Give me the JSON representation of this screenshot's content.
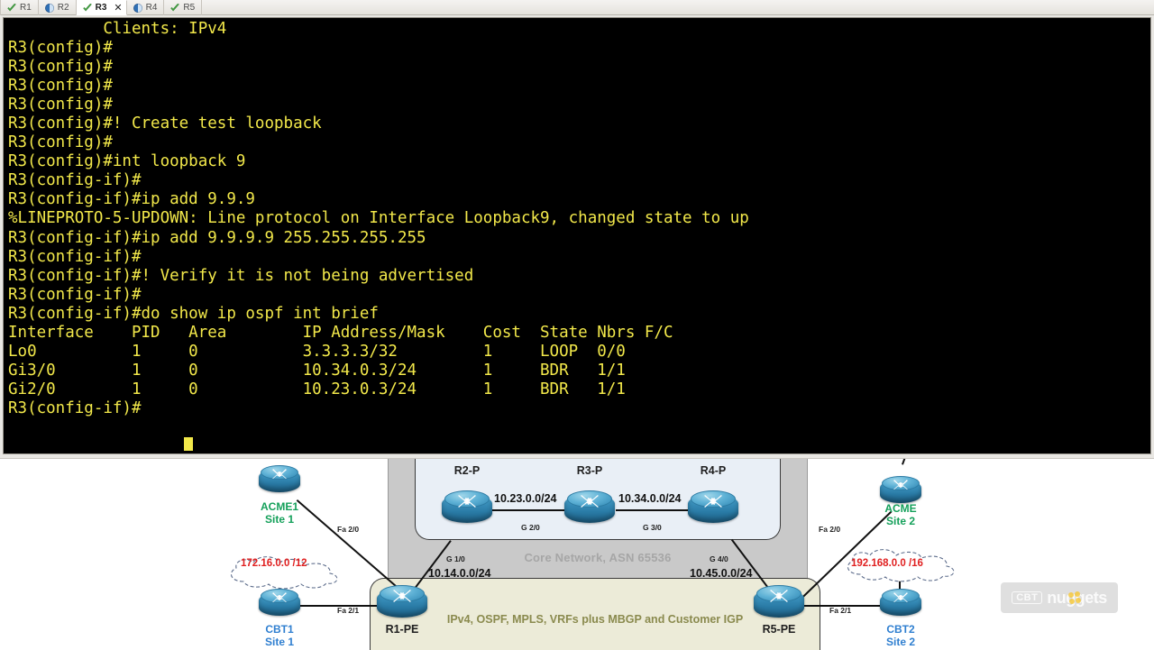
{
  "tabs": [
    {
      "label": "R1",
      "icon": "check-icon",
      "active": false,
      "closable": false
    },
    {
      "label": "R2",
      "icon": "clock-icon",
      "active": false,
      "closable": false
    },
    {
      "label": "R3",
      "icon": "check-icon",
      "active": true,
      "closable": true,
      "close_label": "✕"
    },
    {
      "label": "R4",
      "icon": "clock-icon",
      "active": false,
      "closable": false
    },
    {
      "label": "R5",
      "icon": "check-icon",
      "active": false,
      "closable": false
    }
  ],
  "terminal": {
    "foreground_color": "#f2e84a",
    "background_color": "#000000",
    "text": "          Clients: IPv4\nR3(config)#\nR3(config)#\nR3(config)#\nR3(config)#\nR3(config)#! Create test loopback\nR3(config)#\nR3(config)#int loopback 9\nR3(config-if)#\nR3(config-if)#ip add 9.9.9\n%LINEPROTO-5-UPDOWN: Line protocol on Interface Loopback9, changed state to up\nR3(config-if)#ip add 9.9.9.9 255.255.255.255\nR3(config-if)#\nR3(config-if)#! Verify it is not being advertised\nR3(config-if)#\nR3(config-if)#do show ip ospf int brief\nInterface    PID   Area        IP Address/Mask    Cost  State Nbrs F/C\nLo0          1     0           3.3.3.3/32         1     LOOP  0/0\nGi3/0        1     0           10.34.0.3/24       1     BDR   1/1\nGi2/0        1     0           10.23.0.3/24       1     BDR   1/1\nR3(config-if)#",
    "ospf_table": {
      "headers": [
        "Interface",
        "PID",
        "Area",
        "IP Address/Mask",
        "Cost",
        "State",
        "Nbrs F/C"
      ],
      "rows": [
        [
          "Lo0",
          "1",
          "0",
          "3.3.3.3/32",
          "1",
          "LOOP",
          "0/0"
        ],
        [
          "Gi3/0",
          "1",
          "0",
          "10.34.0.3/24",
          "1",
          "BDR",
          "1/1"
        ],
        [
          "Gi2/0",
          "1",
          "0",
          "10.23.0.3/24",
          "1",
          "BDR",
          "1/1"
        ]
      ]
    },
    "prompt": "R3(config-if)#"
  },
  "diagram": {
    "core_label": "Core Network, ASN 65536",
    "pe_label": "IPv4, OSPF, MPLS, VRFs plus MBGP and Customer IGP",
    "routers": {
      "acme1": {
        "label": "ACME1",
        "sublabel": "Site 1",
        "color": "#14a05a"
      },
      "cbt1": {
        "label": "CBT1",
        "sublabel": "Site 1",
        "color": "#2f7fd0"
      },
      "acme2": {
        "label": "ACME",
        "sublabel": "Site 2",
        "color": "#14a05a"
      },
      "cbt2": {
        "label": "CBT2",
        "sublabel": "Site 2",
        "color": "#2f7fd0"
      },
      "r1pe": {
        "label": "R1-PE"
      },
      "r2p": {
        "label": "R2-P"
      },
      "r3p": {
        "label": "R3-P"
      },
      "r4p": {
        "label": "R4-P"
      },
      "r5pe": {
        "label": "R5-PE"
      }
    },
    "networks": {
      "n1023": "10.23.0.0/24",
      "n1034": "10.34.0.0/24",
      "n1014": "10.14.0.0/24",
      "n1045": "10.45.0.0/24"
    },
    "interfaces": {
      "g20": "G 2/0",
      "g30": "G 3/0",
      "g10": "G 1/0",
      "g40": "G 4/0",
      "fa20_left": "Fa 2/0",
      "fa21_left": "Fa 2/1",
      "fa20_right": "Fa 2/0",
      "fa21_right": "Fa 2/1"
    },
    "clouds": {
      "left": "172.16.0.0 /12",
      "right": "192.168.0.0 /16"
    }
  },
  "watermark": {
    "cbt": "CBT",
    "nuggets": "nuggets"
  }
}
